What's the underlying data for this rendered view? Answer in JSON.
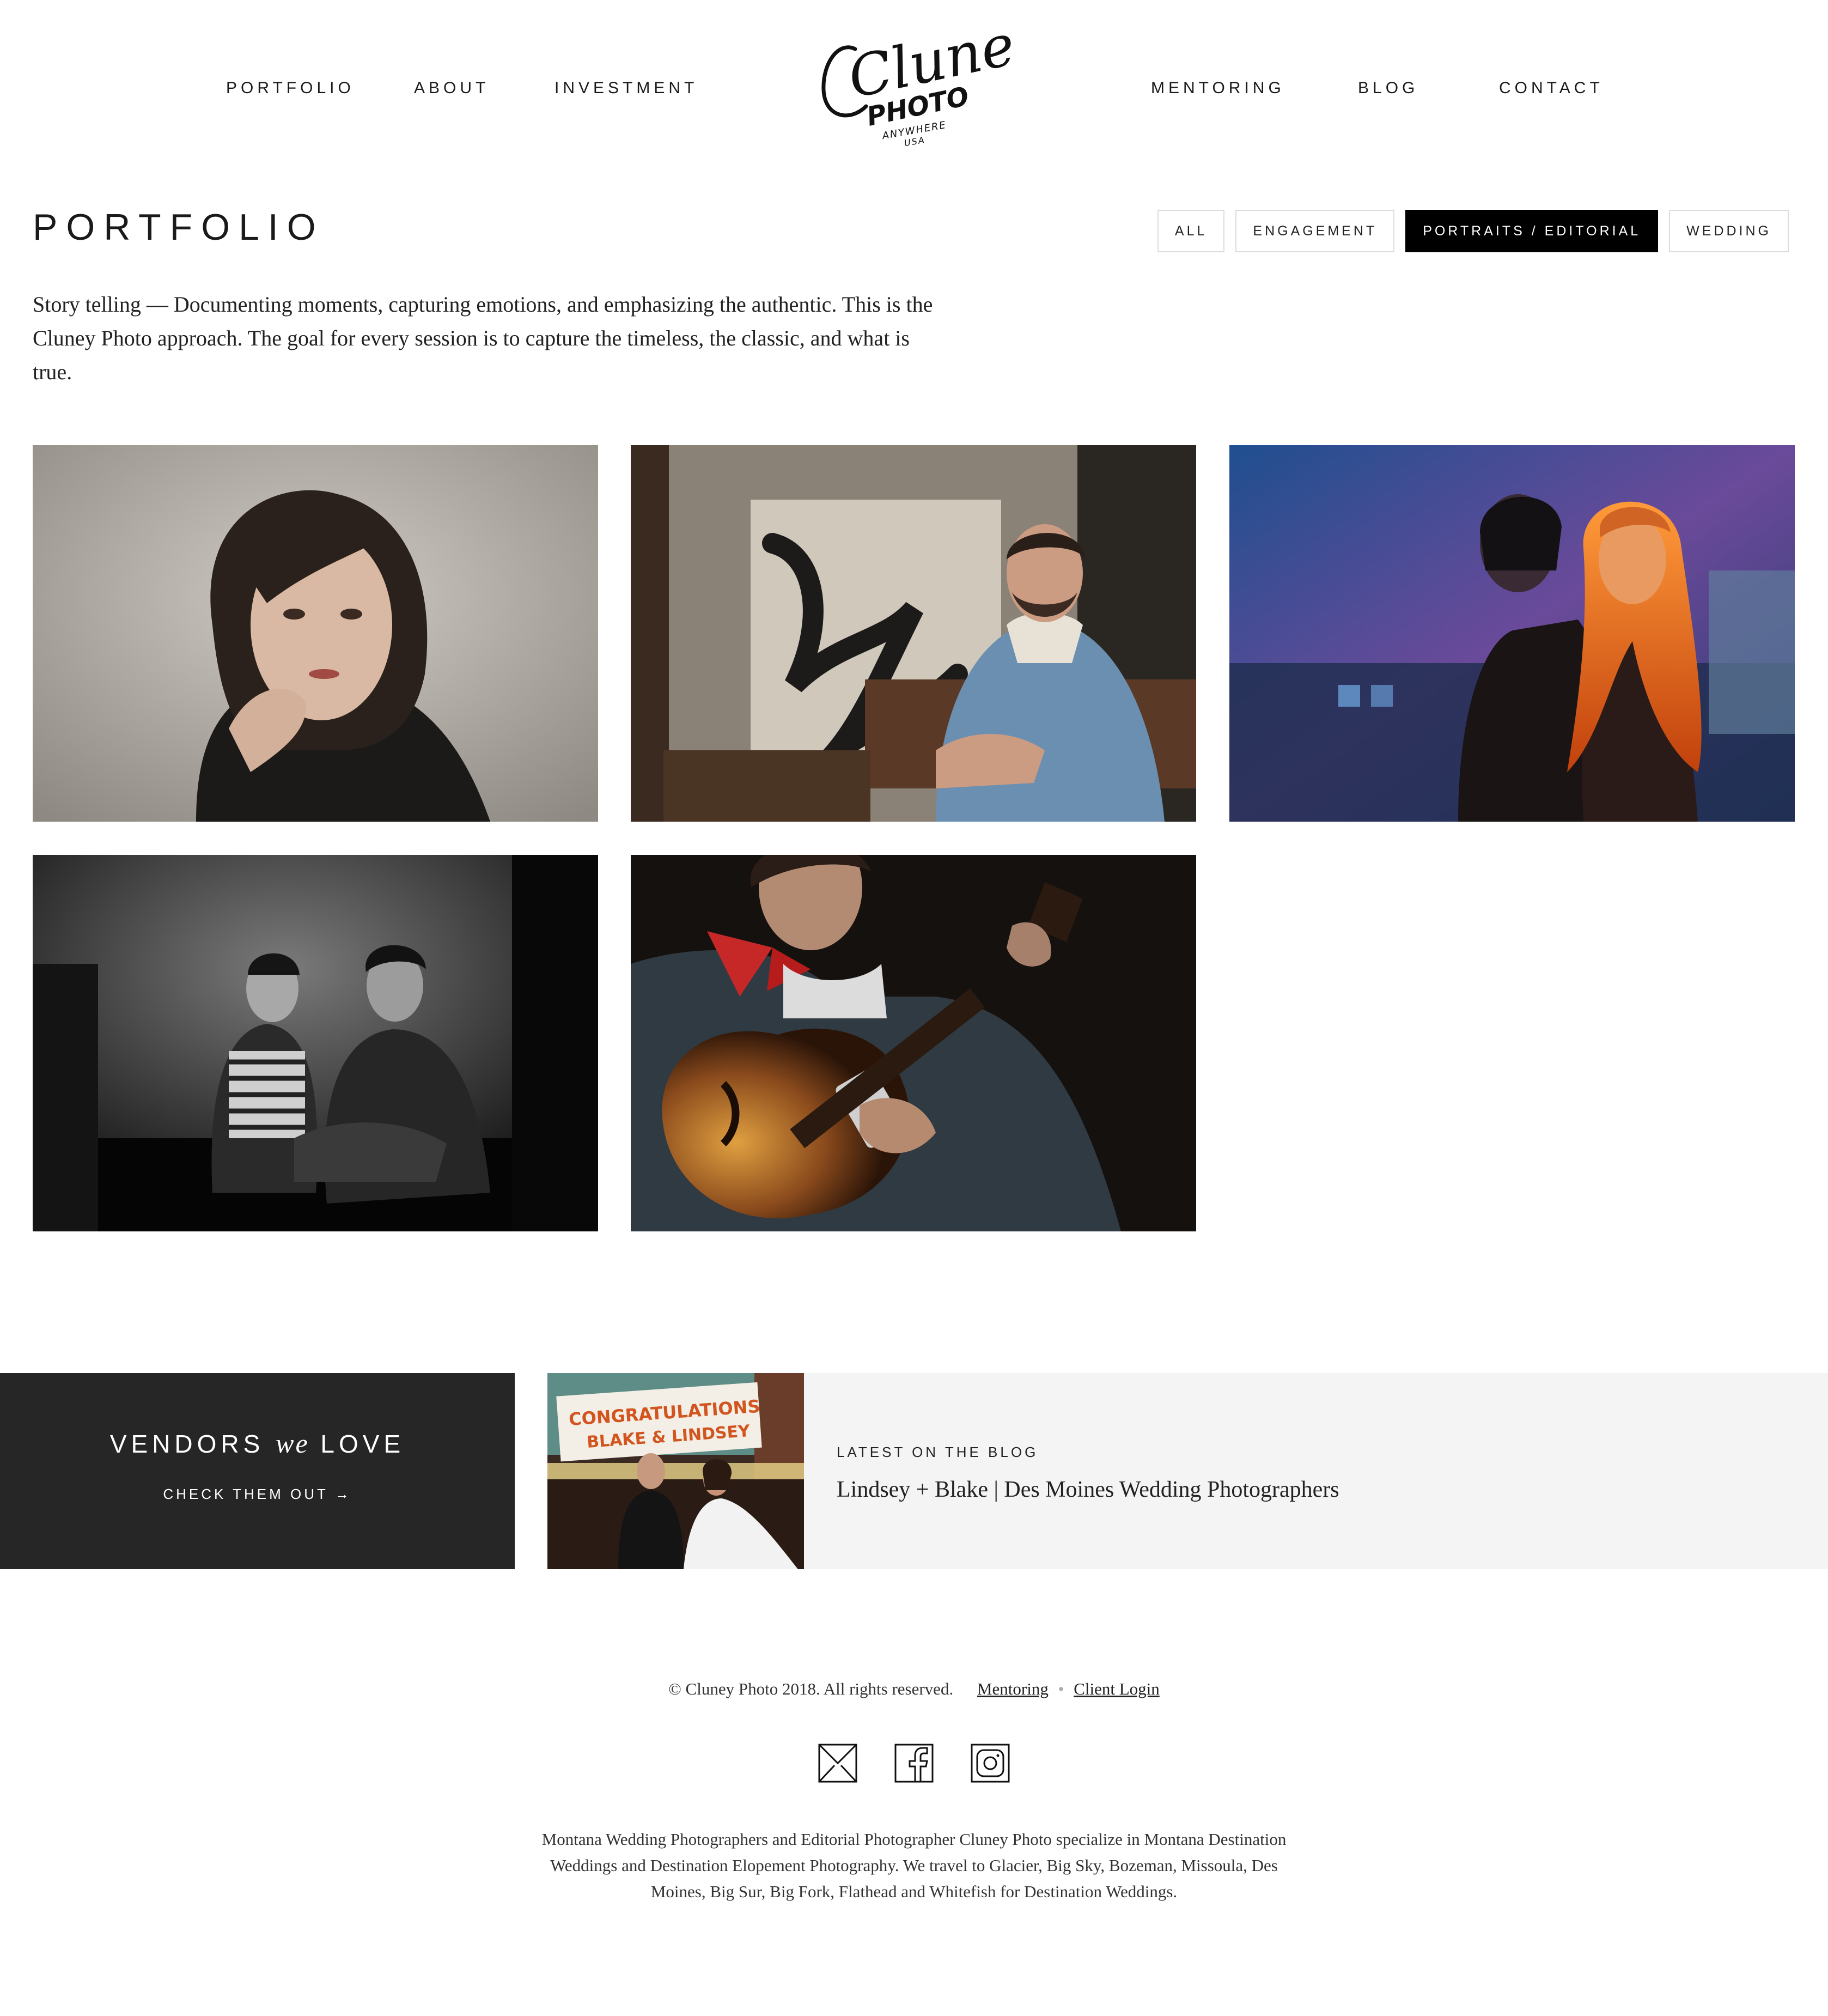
{
  "nav": {
    "left": [
      "PORTFOLIO",
      "ABOUT",
      "INVESTMENT"
    ],
    "right": [
      "MENTORING",
      "BLOG",
      "CONTACT"
    ]
  },
  "logo": {
    "script": "Cluney",
    "word": "PHOTO",
    "tag": "ANYWHERE",
    "sub": "USA"
  },
  "page": {
    "title": "PORTFOLIO",
    "intro": "Story telling — Documenting moments, capturing emotions, and emphasizing the authentic. This is the Cluney Photo approach. The goal for every session is to capture the timeless, the classic, and what is true."
  },
  "filters": [
    {
      "label": "ALL",
      "active": false
    },
    {
      "label": "ENGAGEMENT",
      "active": false
    },
    {
      "label": "PORTRAITS / EDITORIAL",
      "active": true
    },
    {
      "label": "WEDDING",
      "active": false
    }
  ],
  "vendors": {
    "title_pre": "VENDORS",
    "title_em": "we",
    "title_post": "LOVE",
    "cta": "CHECK THEM OUT →"
  },
  "blog": {
    "kicker": "LATEST ON THE BLOG",
    "headline": "Lindsey + Blake | Des Moines Wedding Photographers",
    "marquee_1": "CONGRATULATIONS",
    "marquee_2": "BLAKE & LINDSEY"
  },
  "footer": {
    "copyright": "© Cluney Photo 2018. All rights reserved.",
    "link_mentoring": "Mentoring",
    "sep": "•",
    "link_login": "Client Login",
    "seo": "Montana Wedding Photographers and Editorial Photographer Cluney Photo specialize in Montana Destination Weddings and Destination Elopement Photography. We travel to Glacier, Big Sky, Bozeman, Missoula, Des Moines, Big Sur, Big Fork, Flathead and Whitefish for Destination Weddings."
  },
  "socials": [
    "email-icon",
    "facebook-icon",
    "instagram-icon"
  ],
  "colors": {
    "active_filter": "#000000",
    "vendors_bg": "#262626",
    "blog_bg": "#f4f4f4"
  }
}
